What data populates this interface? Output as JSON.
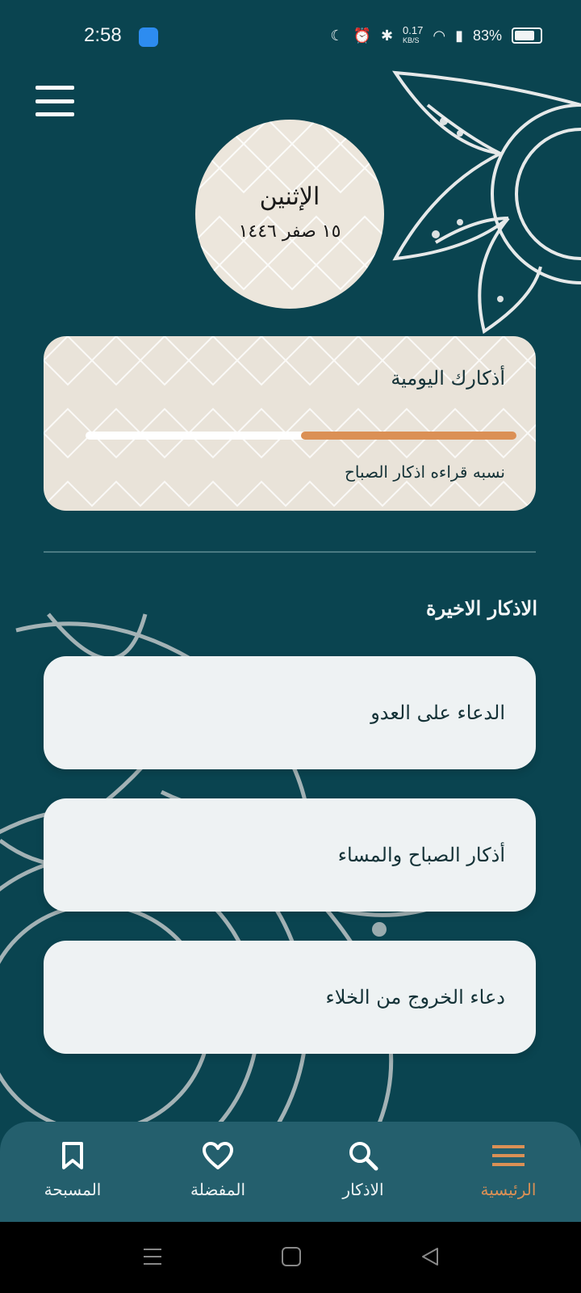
{
  "status_bar": {
    "time": "2:58",
    "net_speed": "0.17",
    "net_unit": "KB/S",
    "battery": "83%"
  },
  "date": {
    "day_name": "الإثنين",
    "hijri_date": "١٥ صفر ١٤٤٦"
  },
  "daily_progress": {
    "title": "أذكارك اليومية",
    "caption": "نسبه قراءه اذكار الصباح",
    "progress_fraction": 0.5
  },
  "recent": {
    "title": "الاذكار الاخيرة",
    "items": [
      "الدعاء على العدو",
      "أذكار الصباح والمساء",
      "دعاء الخروج من الخلاء"
    ]
  },
  "bottom_nav": {
    "items": [
      {
        "label": "المسبحة",
        "icon": "bookmark-icon"
      },
      {
        "label": "المفضلة",
        "icon": "heart-icon"
      },
      {
        "label": "الاذكار",
        "icon": "search-icon"
      },
      {
        "label": "الرئيسية",
        "icon": "menu-icon"
      }
    ],
    "active_index": 3
  },
  "colors": {
    "background": "#0a4450",
    "accent": "#db9055",
    "nav_background": "#245f6d",
    "card_background": "#eef2f3"
  }
}
